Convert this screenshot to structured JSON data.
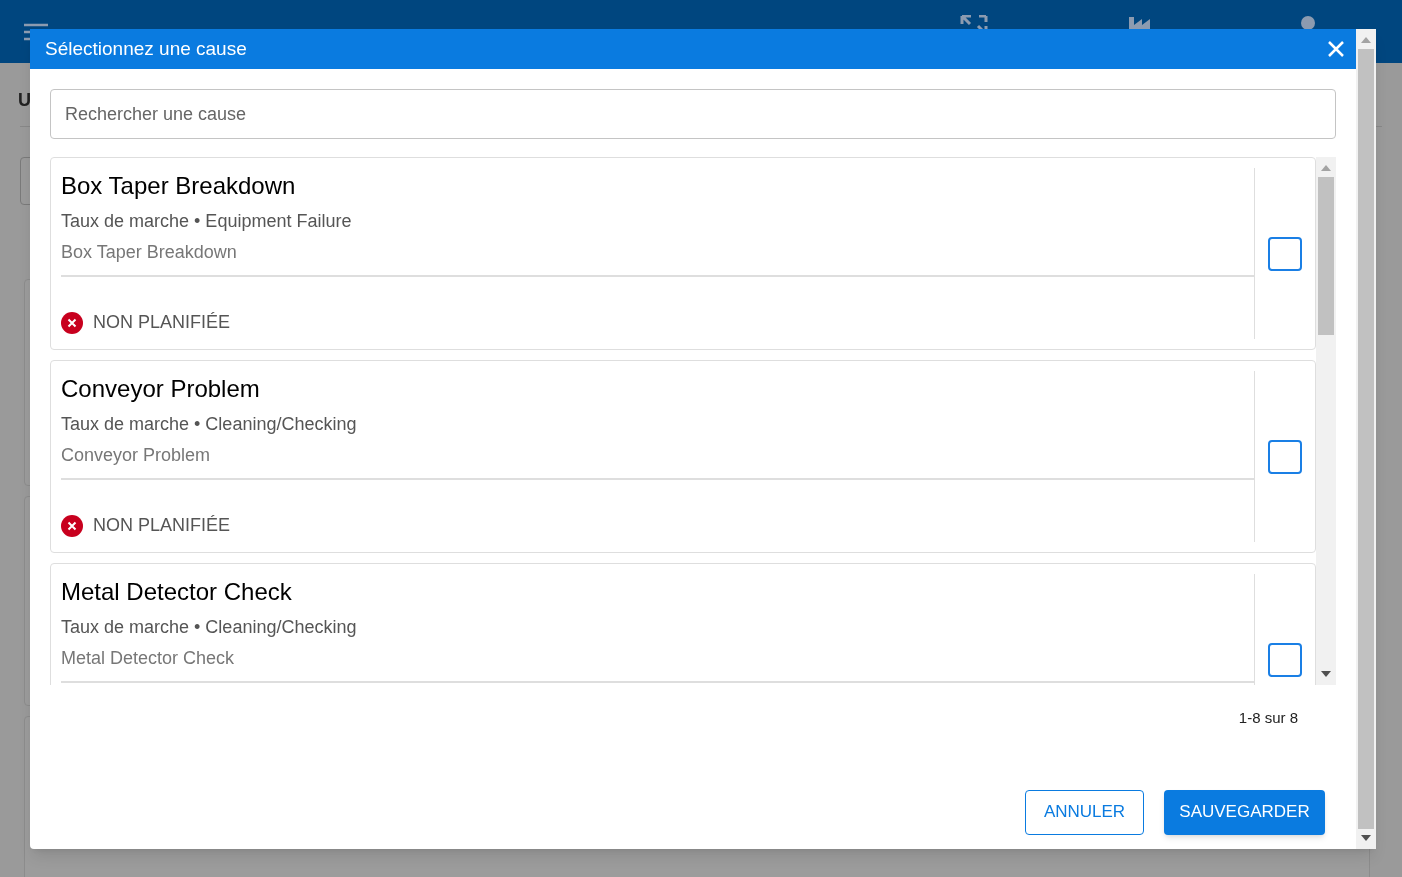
{
  "app_bar": {
    "items": [
      {
        "kind": "fullscreen"
      },
      {
        "kind": "factory"
      },
      {
        "kind": "person"
      }
    ]
  },
  "page": {
    "title": "U"
  },
  "dialog": {
    "title": "Sélectionnez une cause",
    "search": {
      "placeholder": "Rechercher une cause"
    },
    "causes": [
      {
        "title": "Box Taper Breakdown",
        "category": "Taux de marche • Equipment Failure",
        "description": "Box Taper Breakdown",
        "status": {
          "label": "NON PLANIFIÉE",
          "kind": "unplanned"
        },
        "checked": false
      },
      {
        "title": "Conveyor Problem",
        "category": "Taux de marche • Cleaning/Checking",
        "description": "Conveyor Problem",
        "status": {
          "label": "NON PLANIFIÉE",
          "kind": "unplanned"
        },
        "checked": false
      },
      {
        "title": "Metal Detector Check",
        "category": "Taux de marche • Cleaning/Checking",
        "description": "Metal Detector Check",
        "checked": false
      }
    ],
    "pagination": "1-8 sur 8",
    "buttons": [
      {
        "label": "ANNULER",
        "kind": "outlined"
      },
      {
        "label": "SAUVEGARDER",
        "kind": "contained"
      }
    ]
  }
}
